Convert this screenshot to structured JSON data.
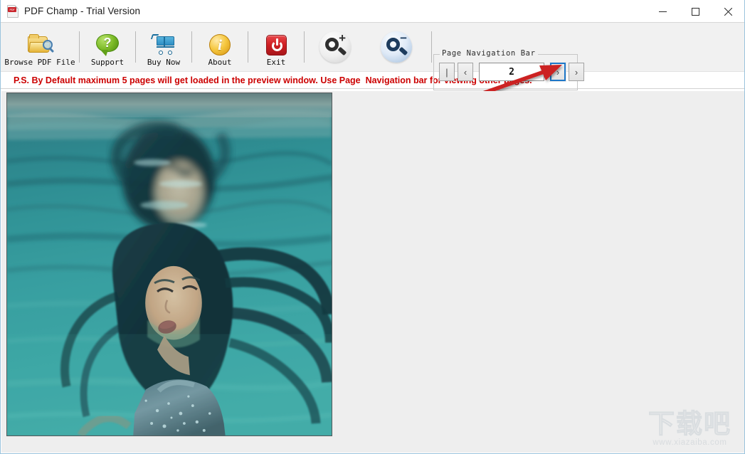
{
  "window": {
    "title": "PDF Champ - Trial Version",
    "app_icon": "pdf-file-icon",
    "icon_badge": "PDF",
    "controls": {
      "minimize": "minimize-icon",
      "maximize": "maximize-icon",
      "close": "close-icon"
    }
  },
  "toolbar": {
    "buttons": [
      {
        "label": "Browse PDF File",
        "icon": "folder-search-icon"
      },
      {
        "label": "Support",
        "icon": "speech-bubble-question-icon"
      },
      {
        "label": "Buy Now",
        "icon": "shopping-cart-icon"
      },
      {
        "label": "About",
        "icon": "info-circle-icon"
      },
      {
        "label": "Exit",
        "icon": "power-button-icon"
      }
    ],
    "zoom_in": {
      "icon": "magnifier-plus-icon",
      "sign": "+"
    },
    "zoom_out": {
      "icon": "magnifier-minus-icon",
      "sign": "−"
    }
  },
  "page_navigation": {
    "legend": "Page Navigation Bar",
    "first_label": "|",
    "prev_label": "‹",
    "next_label": "›",
    "last_label": "›",
    "current_page": "2",
    "focused_button": "next"
  },
  "notice": {
    "text": "P.S. By Default maximum 5 pages will get loaded in the preview window. Use Page  Navigation bar for viewing other pages.",
    "color": "#cc0000"
  },
  "preview": {
    "page_content_description": "underwater-photograph-woman-with-reflection",
    "background_color": "#eeeeee"
  },
  "annotation": {
    "type": "red-arrow",
    "color": "#cc2020",
    "points_to": "next-page-button"
  },
  "watermark": {
    "text_cn": "下载吧",
    "url": "www.xiazaiba.com"
  }
}
